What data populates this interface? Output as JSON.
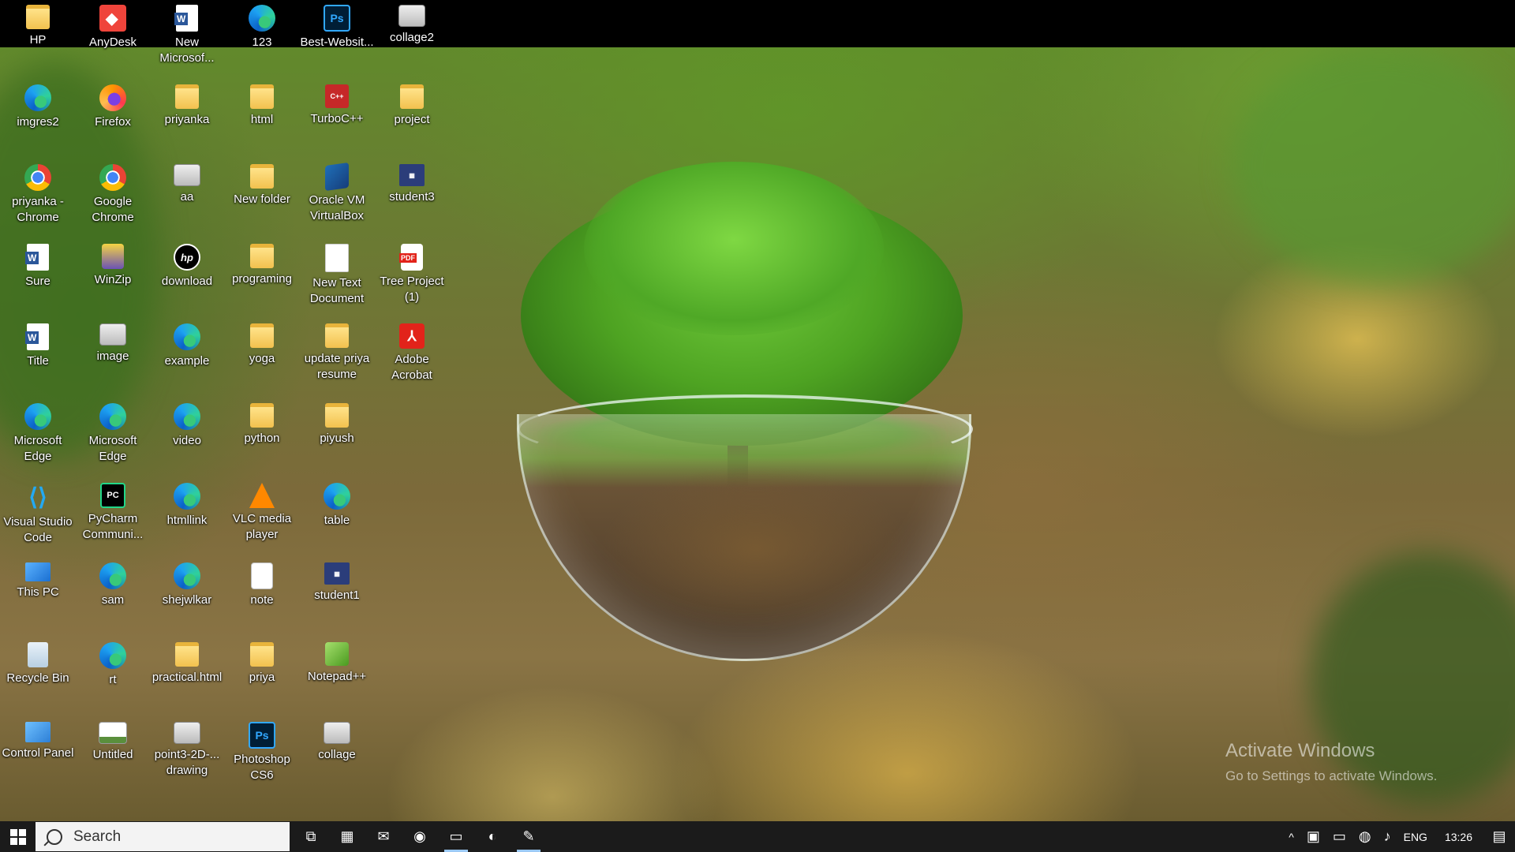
{
  "desktop": {
    "icons": [
      {
        "label": "HP",
        "kind": "folder"
      },
      {
        "label": "AnyDesk",
        "kind": "anydesk"
      },
      {
        "label": "New Microsof...",
        "kind": "word"
      },
      {
        "label": "123",
        "kind": "edge"
      },
      {
        "label": "Best-Websit...",
        "kind": "ps"
      },
      {
        "label": "collage2",
        "kind": "img"
      },
      {
        "label": "imgres2",
        "kind": "edge"
      },
      {
        "label": "Firefox",
        "kind": "firefox"
      },
      {
        "label": "priyanka",
        "kind": "folder"
      },
      {
        "label": "html",
        "kind": "folder"
      },
      {
        "label": "TurboC++",
        "kind": "turbo"
      },
      {
        "label": "project",
        "kind": "folder"
      },
      {
        "label": "priyanka - Chrome",
        "kind": "chrome"
      },
      {
        "label": "Google Chrome",
        "kind": "chrome"
      },
      {
        "label": "aa",
        "kind": "img"
      },
      {
        "label": "New folder",
        "kind": "folder"
      },
      {
        "label": "Oracle VM VirtualBox",
        "kind": "vbox"
      },
      {
        "label": "student3",
        "kind": "dark"
      },
      {
        "label": "Sure",
        "kind": "word"
      },
      {
        "label": "WinZip",
        "kind": "winzip"
      },
      {
        "label": "download",
        "kind": "hp"
      },
      {
        "label": "programing",
        "kind": "folder"
      },
      {
        "label": "New Text Document",
        "kind": "doc"
      },
      {
        "label": "Tree Project (1)",
        "kind": "pdf"
      },
      {
        "label": "Title",
        "kind": "word"
      },
      {
        "label": "image",
        "kind": "img"
      },
      {
        "label": "example",
        "kind": "edge"
      },
      {
        "label": "yoga",
        "kind": "folder"
      },
      {
        "label": "update priya resume",
        "kind": "folder"
      },
      {
        "label": "Adobe Acrobat",
        "kind": "acro"
      },
      {
        "label": "Microsoft Edge",
        "kind": "edge"
      },
      {
        "label": "Microsoft Edge",
        "kind": "edge"
      },
      {
        "label": "video",
        "kind": "edge"
      },
      {
        "label": "python",
        "kind": "folder"
      },
      {
        "label": "piyush",
        "kind": "folder"
      },
      null,
      {
        "label": "Visual Studio Code",
        "kind": "vs"
      },
      {
        "label": "PyCharm Communi...",
        "kind": "pycharm"
      },
      {
        "label": "htmllink",
        "kind": "edge"
      },
      {
        "label": "VLC media player",
        "kind": "vlc"
      },
      {
        "label": "table",
        "kind": "edge"
      },
      null,
      {
        "label": "This PC",
        "kind": "pc"
      },
      {
        "label": "sam",
        "kind": "edge"
      },
      {
        "label": "shejwlkar",
        "kind": "edge"
      },
      {
        "label": "note",
        "kind": "file"
      },
      {
        "label": "student1",
        "kind": "dark"
      },
      null,
      {
        "label": "Recycle Bin",
        "kind": "bin"
      },
      {
        "label": "rt",
        "kind": "edge"
      },
      {
        "label": "practical.html",
        "kind": "folder"
      },
      {
        "label": "priya",
        "kind": "folder"
      },
      {
        "label": "Notepad++",
        "kind": "npp"
      },
      null,
      {
        "label": "Control Panel",
        "kind": "panel"
      },
      {
        "label": "Untitled",
        "kind": "untitled"
      },
      {
        "label": "point3-2D-... drawing",
        "kind": "img"
      },
      {
        "label": "Photoshop CS6",
        "kind": "ps"
      },
      {
        "label": "collage",
        "kind": "img"
      },
      null
    ]
  },
  "icon_glyphs": {
    "ps": "Ps",
    "hp": "hp",
    "acro": "⅄",
    "vs": "⟨⟩",
    "pycharm": "PC",
    "turbo": "C++",
    "dark": "▦"
  },
  "watermark": {
    "title": "Activate Windows",
    "subtitle": "Go to Settings to activate Windows."
  },
  "taskbar": {
    "search_placeholder": "Search",
    "apps": [
      {
        "name": "task-view-icon",
        "glyph": "⧉"
      },
      {
        "name": "store-icon",
        "glyph": "▦"
      },
      {
        "name": "mail-icon",
        "glyph": "✉"
      },
      {
        "name": "zoom-icon",
        "glyph": "◉"
      },
      {
        "name": "file-explorer-icon",
        "glyph": "▭"
      },
      {
        "name": "edge-icon",
        "glyph": "◐"
      },
      {
        "name": "notepadpp-icon",
        "glyph": "✎"
      }
    ],
    "tray": {
      "chevron": "^",
      "language": "ENG",
      "time": "13:26"
    }
  }
}
